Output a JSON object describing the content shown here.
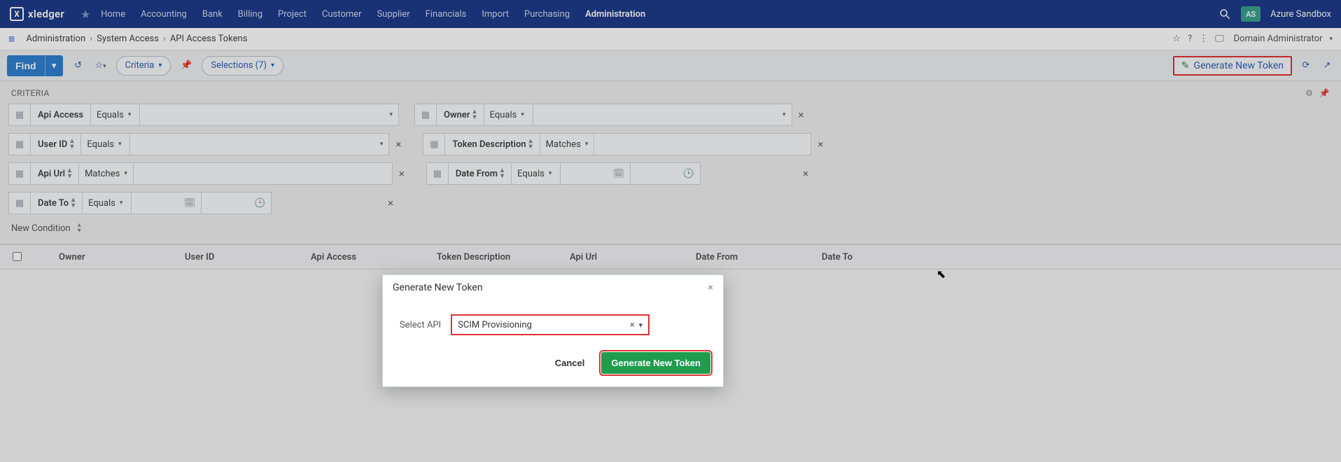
{
  "brand": {
    "name": "xledger"
  },
  "nav": {
    "items": [
      {
        "label": "Home"
      },
      {
        "label": "Accounting"
      },
      {
        "label": "Bank"
      },
      {
        "label": "Billing"
      },
      {
        "label": "Project"
      },
      {
        "label": "Customer"
      },
      {
        "label": "Supplier"
      },
      {
        "label": "Financials"
      },
      {
        "label": "Import"
      },
      {
        "label": "Purchasing"
      },
      {
        "label": "Administration",
        "active": true
      }
    ],
    "avatar_initials": "AS",
    "account_name": "Azure Sandbox"
  },
  "breadcrumbs": {
    "items": [
      "Administration",
      "System Access",
      "API Access Tokens"
    ],
    "domain_role": "Domain Administrator"
  },
  "toolbar": {
    "find_label": "Find",
    "criteria_label": "Criteria",
    "selections_label": "Selections (7)",
    "generate_label": "Generate New Token"
  },
  "criteria": {
    "title": "CRITERIA",
    "new_condition_label": "New Condition",
    "fields": {
      "api_access": {
        "label": "Api Access",
        "op": "Equals"
      },
      "owner": {
        "label": "Owner",
        "op": "Equals"
      },
      "user_id": {
        "label": "User ID",
        "op": "Equals"
      },
      "token_desc": {
        "label": "Token Description",
        "op": "Matches"
      },
      "api_url": {
        "label": "Api Url",
        "op": "Matches"
      },
      "date_from": {
        "label": "Date From",
        "op": "Equals"
      },
      "date_to": {
        "label": "Date To",
        "op": "Equals"
      }
    }
  },
  "grid": {
    "columns": {
      "owner": "Owner",
      "user_id": "User ID",
      "api_access": "Api Access",
      "token_desc": "Token Description",
      "api_url": "Api Url",
      "date_from": "Date From",
      "date_to": "Date To"
    }
  },
  "modal": {
    "title": "Generate New Token",
    "select_label": "Select API",
    "select_value": "SCIM Provisioning",
    "cancel_label": "Cancel",
    "submit_label": "Generate New Token"
  }
}
